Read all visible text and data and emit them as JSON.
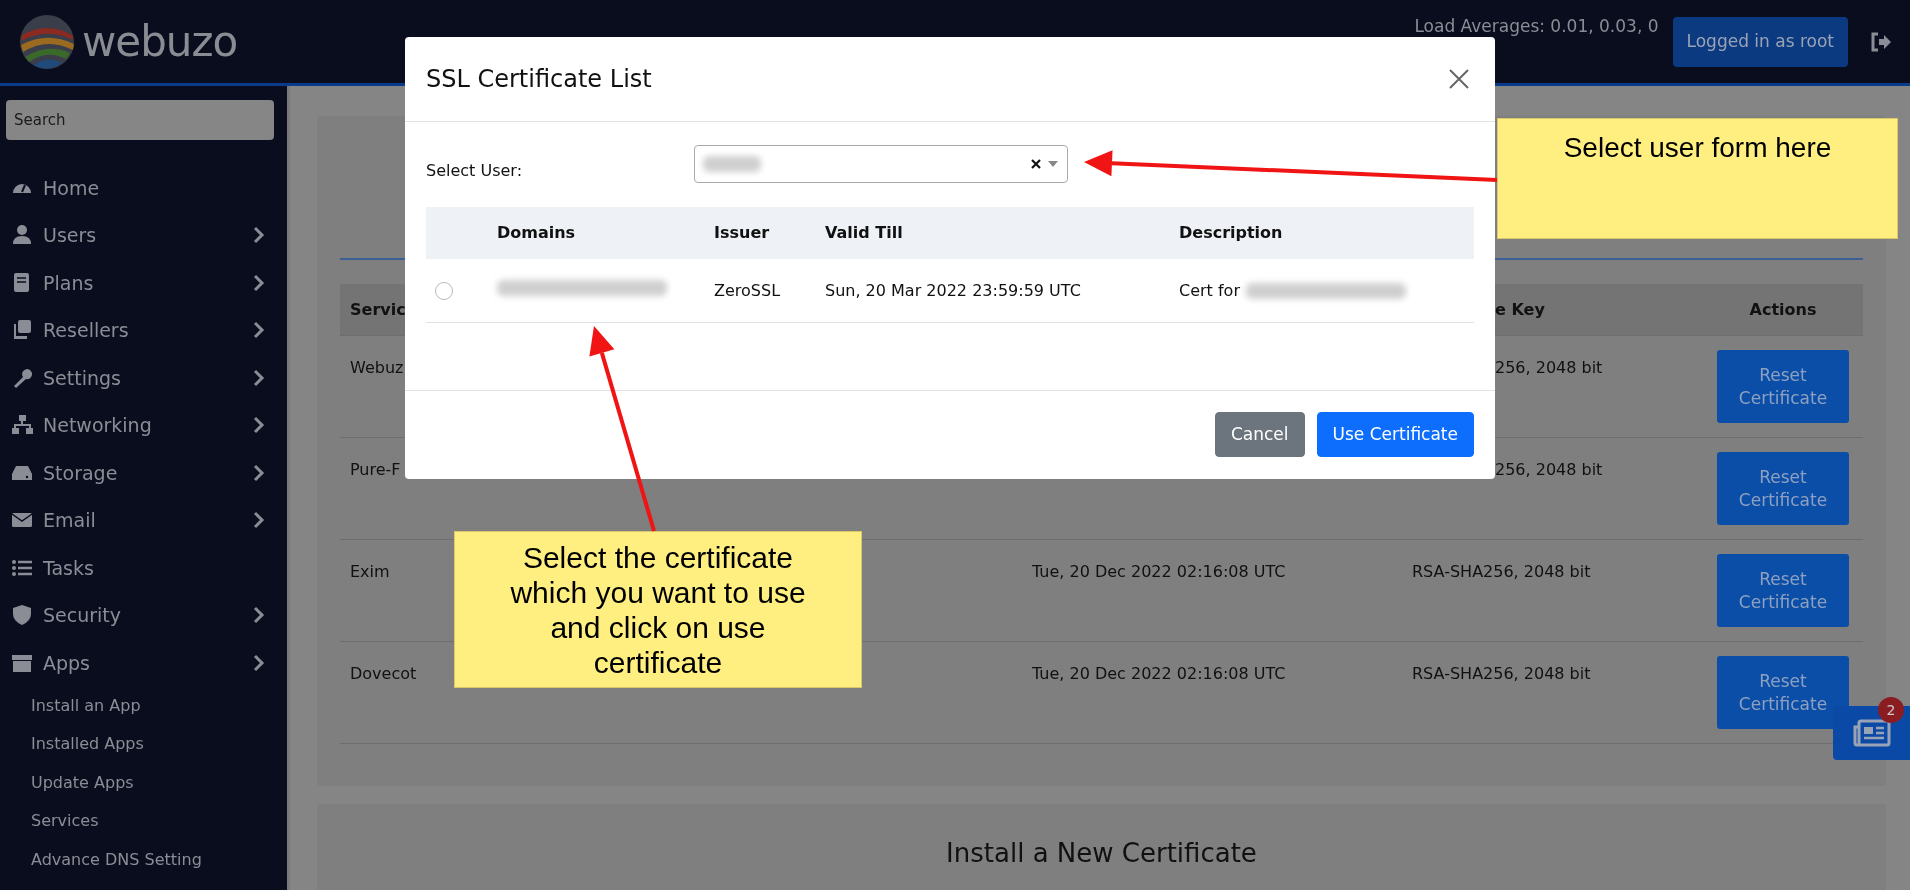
{
  "header": {
    "logo": "webuzo",
    "load_averages": "Load Averages: 0.01, 0.03, 0",
    "user_button": "Logged in as root"
  },
  "sidebar": {
    "search": {
      "placeholder": "Search"
    },
    "items": [
      {
        "label": "Home",
        "submenu": false
      },
      {
        "label": "Users",
        "submenu": true
      },
      {
        "label": "Plans",
        "submenu": true
      },
      {
        "label": "Resellers",
        "submenu": true
      },
      {
        "label": "Settings",
        "submenu": true
      },
      {
        "label": "Networking",
        "submenu": true
      },
      {
        "label": "Storage",
        "submenu": true
      },
      {
        "label": "Email",
        "submenu": true
      },
      {
        "label": "Tasks",
        "submenu": false
      },
      {
        "label": "Security",
        "submenu": true
      },
      {
        "label": "Apps",
        "submenu": true,
        "children": [
          {
            "label": "Install an App"
          },
          {
            "label": "Installed Apps"
          },
          {
            "label": "Update Apps"
          },
          {
            "label": "Services"
          },
          {
            "label": "Advance DNS Setting"
          }
        ]
      }
    ]
  },
  "certificates_card": {
    "header": {
      "service": "Servic",
      "key": "e Key",
      "key_cut": true,
      "actions": "Actions"
    },
    "rows": [
      {
        "service": "Webuz",
        "key": "256, 2048 bit",
        "key_cut": true,
        "action": "Reset Certificate"
      },
      {
        "service": "Pure-F",
        "key": "256, 2048 bit",
        "key_cut": true,
        "action": "Reset Certificate"
      },
      {
        "service": "Exim",
        "expires": "Tue, 20 Dec 2022 02:16:08 UTC",
        "key": "RSA-SHA256, 2048 bit",
        "action": "Reset Certificate"
      },
      {
        "service": "Dovecot",
        "expires": "Tue, 20 Dec 2022 02:16:08 UTC",
        "key": "RSA-SHA256, 2048 bit",
        "action": "Reset Certificate"
      }
    ]
  },
  "install_card": {
    "title": "Install a New Certificate"
  },
  "news_button": {
    "badge": "2"
  },
  "modal": {
    "title": "SSL Certificate List",
    "select_user": {
      "label": "Select User:"
    },
    "columns": [
      "Domains",
      "Issuer",
      "Valid Till",
      "Description"
    ],
    "rows": [
      {
        "selected": false,
        "issuer": "ZeroSSL",
        "valid_till": "Sun, 20 Mar 2022 23:59:59 UTC",
        "description": "Cert for"
      }
    ],
    "buttons": [
      {
        "label": "Cancel",
        "kind": "secondary"
      },
      {
        "label": "Use Certificate",
        "kind": "primary"
      }
    ]
  },
  "annotations": [
    {
      "text": "Select user form here"
    },
    {
      "text": "Select the certificate which you want to use and click on use certificate"
    }
  ]
}
